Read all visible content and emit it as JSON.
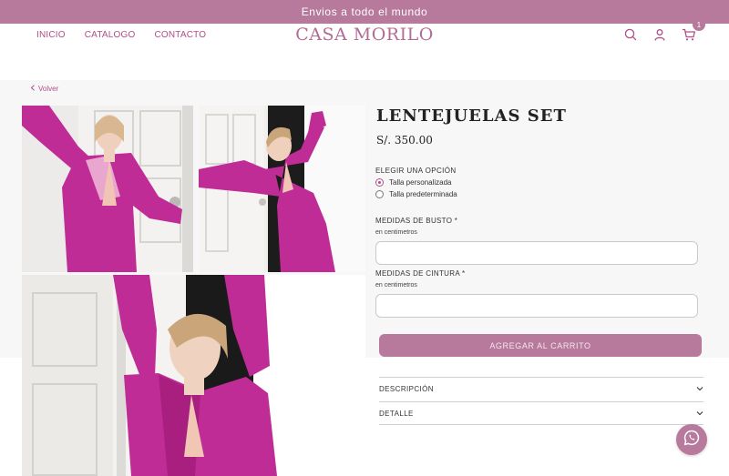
{
  "announcement": "Envios a todo el mundo",
  "nav": {
    "items": [
      "INICIO",
      "CATALOGO",
      "CONTACTO"
    ]
  },
  "logo": "CASA MORILO",
  "header": {
    "cart_count": "1",
    "icons": [
      "search-icon",
      "user-icon",
      "cart-icon"
    ]
  },
  "back": {
    "label": "Volver"
  },
  "product": {
    "title": "LENTEJUELAS SET",
    "price": "S/. 350.00",
    "option_label": "ELEGIR UNA OPCIÓN",
    "options": [
      "Talla personalizada",
      "Talla predeterminada"
    ],
    "selected_option": "Talla personalizada",
    "fields": [
      {
        "label": "MEDIDAS DE BUSTO *",
        "hint": "en centimetros",
        "value": ""
      },
      {
        "label": "MEDIDAS DE CINTURA *",
        "hint": "en centimetros",
        "value": ""
      }
    ],
    "cta": "AGREGAR AL CARRITO",
    "accordion": [
      "DESCRIPCIÓN",
      "DETALLE"
    ]
  },
  "colors": {
    "brand": "#b7799c",
    "accent_text": "#b04f88",
    "sequin": "#c02c96"
  }
}
